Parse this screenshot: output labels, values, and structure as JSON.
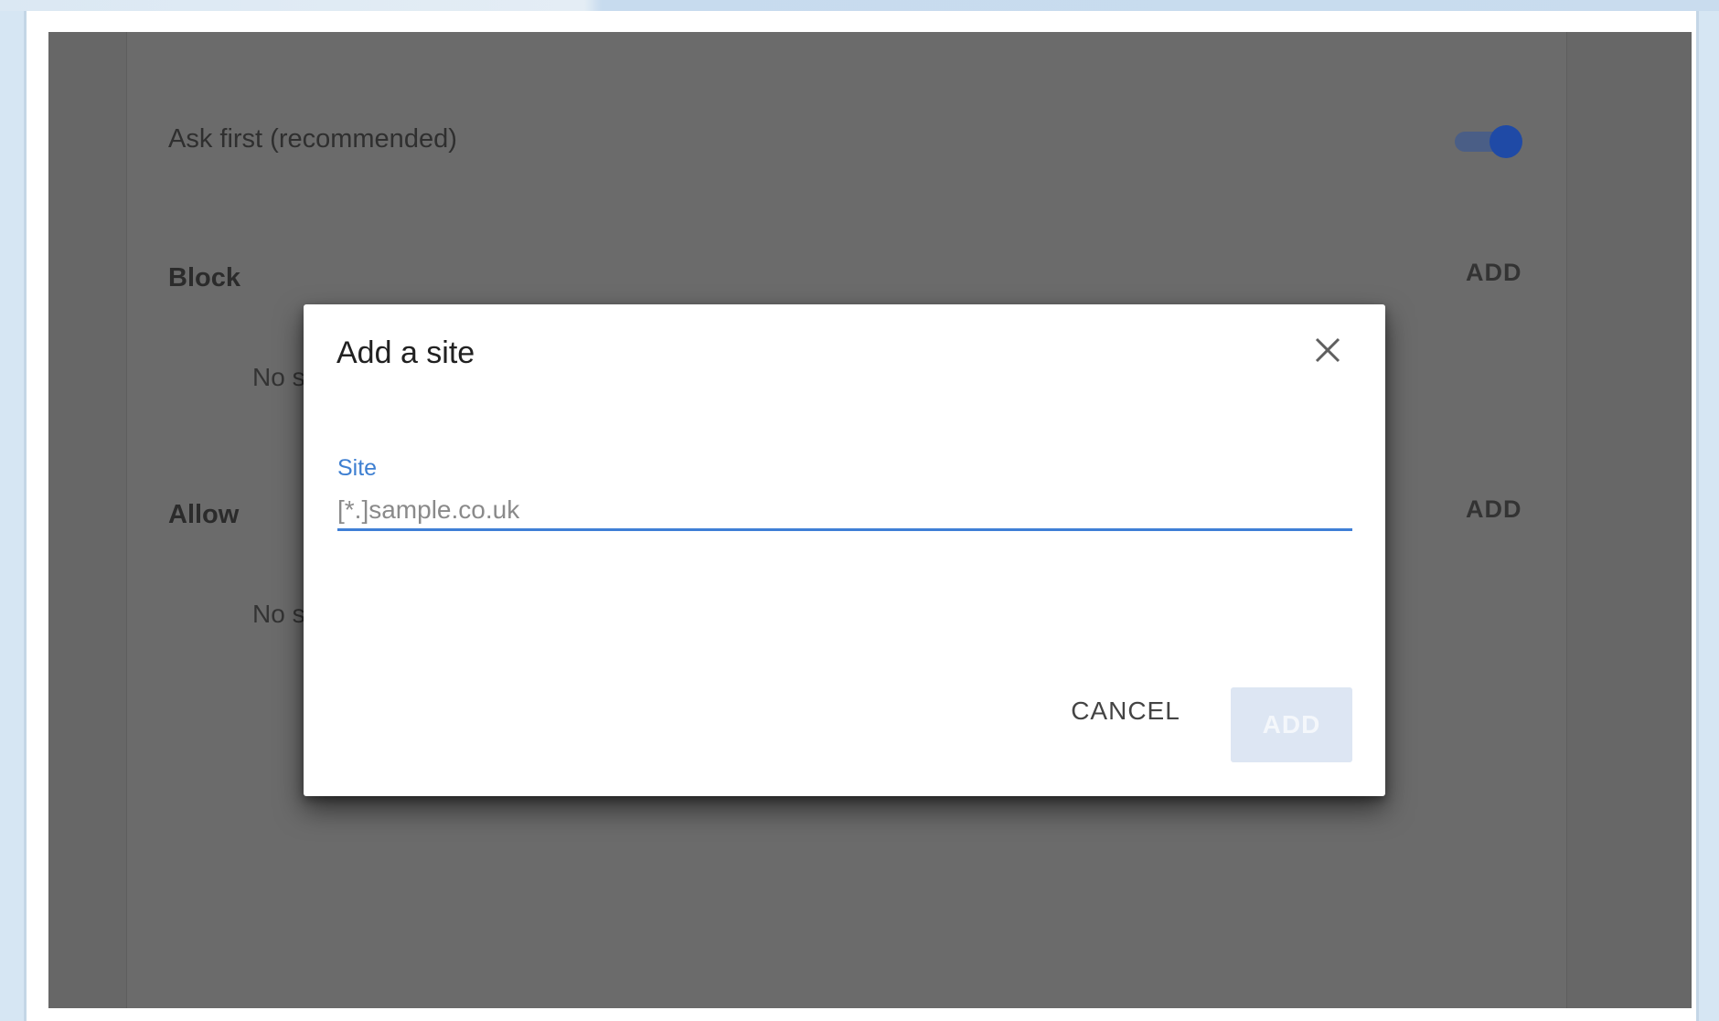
{
  "settings": {
    "ask_first_label": "Ask first (recommended)",
    "ask_first_enabled": true,
    "block_section_label": "Block",
    "allow_section_label": "Allow",
    "block_add_label": "ADD",
    "allow_add_label": "ADD",
    "block_empty_text": "No s",
    "allow_empty_text": "No s"
  },
  "dialog": {
    "title": "Add a site",
    "close_icon": "close-icon",
    "field_label": "Site",
    "field_placeholder": "[*.]sample.co.uk",
    "field_value": "",
    "cancel_label": "CANCEL",
    "add_label": "ADD",
    "add_enabled": false
  },
  "colors": {
    "accent": "#3f7fd6",
    "toggle_thumb": "#1f4aa6",
    "scrim": "#676767"
  }
}
